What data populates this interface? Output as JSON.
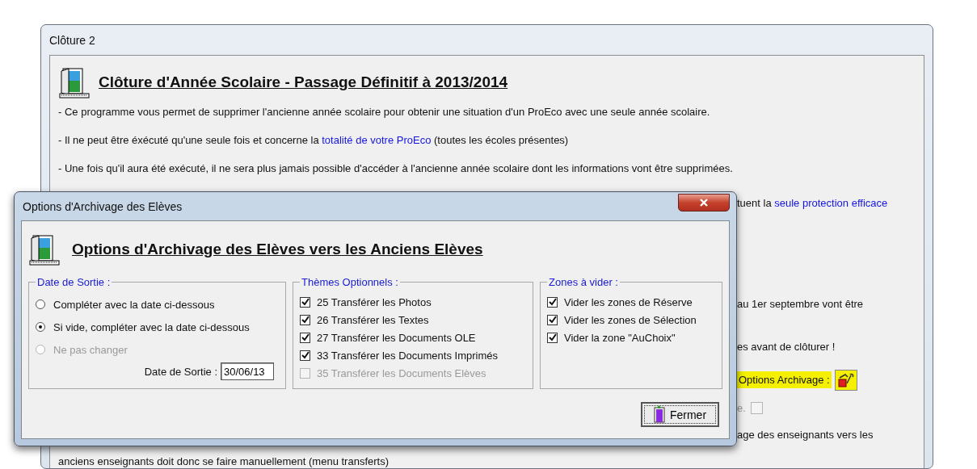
{
  "main_window": {
    "title": "Clôture 2",
    "heading": "Clôture d'Année Scolaire - Passage Définitif à 2013/2014",
    "paragraphs": [
      {
        "text": "- Ce programme vous permet de supprimer l'ancienne année scolaire pour obtenir une situation d'un ProEco avec une seule année scolaire."
      },
      {
        "text": "- Il ne peut être éxécuté qu'une seule fois et concerne la ",
        "link": "totalité de votre ProEco",
        "text_after": " (toutes les écoles présentes)"
      },
      {
        "text": "- Une fois qu'il aura été exécuté, il ne sera plus jamais possible d'accéder à l'ancienne année scolaire dont les informations vont être supprimées."
      }
    ],
    "fragments": [
      {
        "kind": "text",
        "clipped_left": true,
        "text": "tuent la ",
        "link": "seule protection efficace"
      },
      {
        "kind": "text",
        "clipped_left": true,
        "text": "au 1er septembre vont être"
      },
      {
        "kind": "text",
        "clipped_left": true,
        "text": "es avant de clôturer !"
      },
      {
        "kind": "options",
        "clipped_left": true,
        "label": "Options Archivage :",
        "highlighted": true
      },
      {
        "kind": "checkbox",
        "clipped_left": true,
        "label": "e.",
        "checked": false,
        "disabled": true
      },
      {
        "kind": "text",
        "clipped_left": true,
        "text": "age des enseignants vers les"
      },
      {
        "kind": "text",
        "clipped_left": false,
        "text": "anciens enseignants doit donc se faire manuellement (menu transferts)"
      }
    ]
  },
  "dialog": {
    "title": "Options d'Archivage des Elèves",
    "heading": "Options d'Archivage des Elèves vers les Anciens Elèves",
    "groups": [
      {
        "kind": "radio",
        "title": "Date de Sortie :",
        "items": [
          {
            "label": "Compléter avec la date ci-dessous",
            "selected": false,
            "disabled": false
          },
          {
            "label": "Si vide, compléter avec la date ci-dessous",
            "selected": true,
            "disabled": false
          },
          {
            "label": "Ne pas changer",
            "selected": false,
            "disabled": true
          }
        ],
        "field": {
          "label": "Date de Sortie :",
          "value": "30/06/13"
        }
      },
      {
        "kind": "checkbox",
        "title": "Thèmes Optionnels :",
        "items": [
          {
            "label": "25 Transférer les Photos",
            "checked": true,
            "disabled": false
          },
          {
            "label": "26 Transférer les Textes",
            "checked": true,
            "disabled": false
          },
          {
            "label": "27 Transférer les Documents OLE",
            "checked": true,
            "disabled": false
          },
          {
            "label": "33 Transférer les Documents Imprimés",
            "checked": true,
            "disabled": false
          },
          {
            "label": "35 Transférer les Documents Elèves",
            "checked": false,
            "disabled": true
          }
        ]
      },
      {
        "kind": "checkbox",
        "title": "Zones à vider :",
        "items": [
          {
            "label": "Vider les zones de Réserve",
            "checked": true,
            "disabled": false
          },
          {
            "label": "Vider les zones de Sélection",
            "checked": true,
            "disabled": false
          },
          {
            "label": "Vider la zone \"AuChoix\"",
            "checked": true,
            "disabled": false
          }
        ]
      }
    ],
    "close_button": "Fermer"
  }
}
